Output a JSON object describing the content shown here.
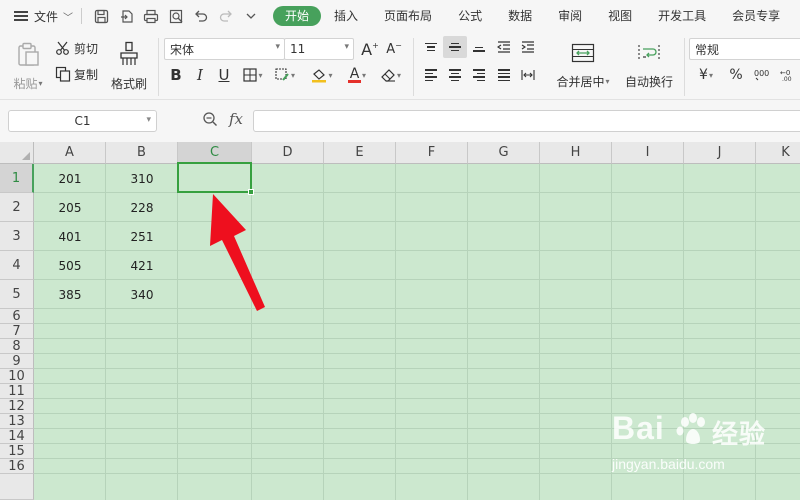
{
  "menubar": {
    "file_label": "文件",
    "tabs": [
      "开始",
      "插入",
      "页面布局",
      "公式",
      "数据",
      "审阅",
      "视图",
      "开发工具",
      "会员专享"
    ],
    "active_tab": "开始"
  },
  "ribbon": {
    "paste_label": "粘贴",
    "cut_label": "剪切",
    "copy_label": "复制",
    "format_painter_label": "格式刷",
    "font_name": "宋体",
    "font_size": "11",
    "grow_font": "A",
    "shrink_font": "A",
    "bold": "B",
    "italic": "I",
    "underline": "U",
    "font_color_glyph": "A",
    "merge_label": "合并居中",
    "wrap_label": "自动换行",
    "number_format": "常规",
    "currency_glyph": "¥",
    "percent_glyph": "%"
  },
  "formula_bar": {
    "name_box": "C1",
    "fx_label": "fx",
    "formula": ""
  },
  "sheet": {
    "columns": [
      "A",
      "B",
      "C",
      "D",
      "E",
      "F",
      "G",
      "H",
      "I",
      "J",
      "K"
    ],
    "selected_column": "C",
    "rows": [
      "1",
      "2",
      "3",
      "4",
      "5",
      "6",
      "7",
      "8",
      "9",
      "10",
      "11",
      "12",
      "13",
      "14",
      "15",
      "16"
    ],
    "selected_row": "1",
    "cells": [
      {
        "a": "201",
        "b": "310"
      },
      {
        "a": "205",
        "b": "228"
      },
      {
        "a": "401",
        "b": "251"
      },
      {
        "a": "505",
        "b": "421"
      },
      {
        "a": "385",
        "b": "340"
      }
    ],
    "selected_cell": "C1"
  },
  "colors": {
    "accent": "#47a15c",
    "sheet_bg": "#cce8cf",
    "selection": "#36a03f",
    "arrow": "#ee0f1e"
  },
  "watermark": {
    "brand": "Bai",
    "brand_suffix": "经验",
    "url": "jingyan.baidu.com"
  }
}
